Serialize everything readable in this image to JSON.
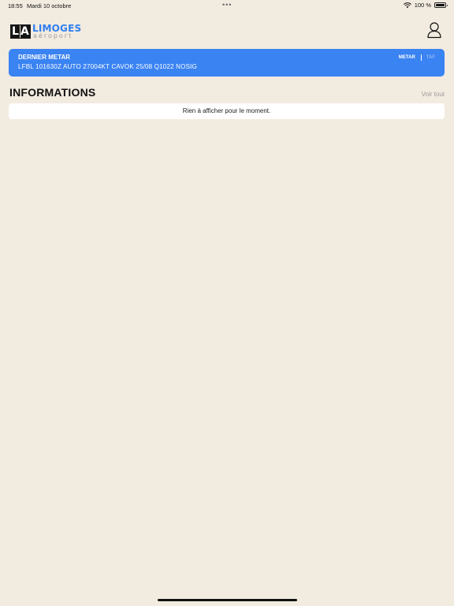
{
  "status_bar": {
    "time": "18:55",
    "date": "Mardi 10 octobre",
    "dots": "•••",
    "battery": "100 %"
  },
  "header": {
    "logo": {
      "mark_letters": [
        "L",
        "A"
      ],
      "title": "LIMOGES",
      "subtitle": "aéroport"
    },
    "profile_icon": "user-icon"
  },
  "metar": {
    "title": "DERNIER METAR",
    "text": "LFBL 101630Z AUTO 27004KT CAVOK 25/08 Q1022 NOSIG",
    "tabs": [
      {
        "label": "METAR",
        "active": true
      },
      {
        "label": "TAF",
        "active": false
      }
    ],
    "background_color": "#3a83f2"
  },
  "informations": {
    "title": "INFORMATIONS",
    "see_all": "Voir tout",
    "empty_message": "Rien à afficher pour le moment."
  },
  "colors": {
    "page_background": "#f2ebe0",
    "accent": "#2f7ff0"
  }
}
